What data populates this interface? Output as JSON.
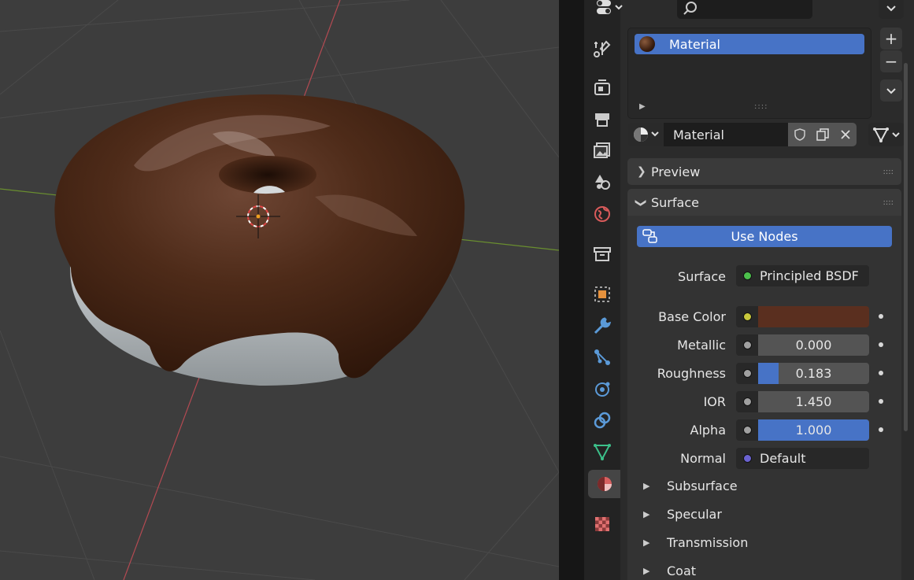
{
  "viewport": {
    "object": "donut-mesh",
    "icing_color": "#4a2a17",
    "dough_color": "#a9aeb0",
    "background_color": "#3d3d3d"
  },
  "properties": {
    "header": {
      "editor_type_icon": "properties-editor-icon",
      "search_icon": "search-icon",
      "search_placeholder": ""
    },
    "tabs": [
      {
        "name": "tool",
        "icon": "tool-icon"
      },
      {
        "name": "render",
        "icon": "render-icon"
      },
      {
        "name": "output",
        "icon": "output-icon"
      },
      {
        "name": "view-layer",
        "icon": "view-layer-icon"
      },
      {
        "name": "scene",
        "icon": "scene-icon"
      },
      {
        "name": "world",
        "icon": "world-icon"
      },
      {
        "name": "collection",
        "icon": "collection-icon"
      },
      {
        "name": "object",
        "icon": "object-icon"
      },
      {
        "name": "modifiers",
        "icon": "wrench-icon"
      },
      {
        "name": "particles",
        "icon": "particles-icon"
      },
      {
        "name": "physics",
        "icon": "physics-icon"
      },
      {
        "name": "constraints",
        "icon": "constraint-icon"
      },
      {
        "name": "data",
        "icon": "mesh-data-icon"
      },
      {
        "name": "material",
        "icon": "material-icon",
        "active": true
      },
      {
        "name": "texture",
        "icon": "texture-icon"
      }
    ],
    "material_slots": {
      "items": [
        "Material"
      ],
      "add_label": "+",
      "remove_label": "−"
    },
    "material_selector": {
      "name": "Material"
    },
    "preview_panel": {
      "title": "Preview"
    },
    "surface_panel": {
      "title": "Surface",
      "use_nodes_label": "Use Nodes",
      "surface_label": "Surface",
      "surface_value": "Principled BSDF",
      "base_color": {
        "label": "Base Color",
        "color": "#5a2f1f"
      },
      "metallic": {
        "label": "Metallic",
        "value": "0.000",
        "fraction": 0.0
      },
      "roughness": {
        "label": "Roughness",
        "value": "0.183",
        "fraction": 0.183
      },
      "ior": {
        "label": "IOR",
        "value": "1.450",
        "fraction": 0.0
      },
      "alpha": {
        "label": "Alpha",
        "value": "1.000",
        "fraction": 1.0
      },
      "normal": {
        "label": "Normal",
        "value": "Default"
      },
      "subpanels": [
        "Subsurface",
        "Specular",
        "Transmission",
        "Coat"
      ]
    }
  }
}
